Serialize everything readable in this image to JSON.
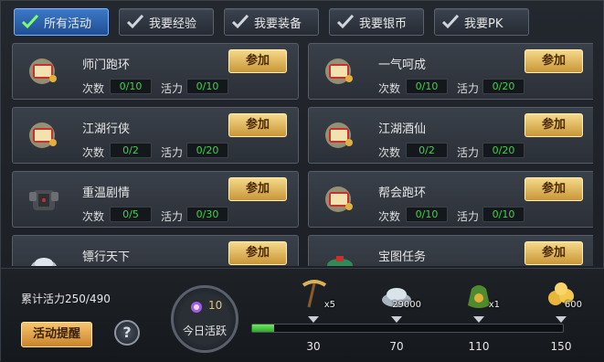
{
  "tabs": [
    {
      "label": "所有活动",
      "active": true
    },
    {
      "label": "我要经验",
      "active": false
    },
    {
      "label": "我要装备",
      "active": false
    },
    {
      "label": "我要银币",
      "active": false
    },
    {
      "label": "我要PK",
      "active": false
    }
  ],
  "labels": {
    "count": "次数",
    "vigor": "活力",
    "join": "参加"
  },
  "activities": [
    {
      "name": "师门跑环",
      "count": "0/10",
      "vigor": "0/10",
      "icon": "scroll-icon"
    },
    {
      "name": "一气呵成",
      "count": "0/10",
      "vigor": "0/20",
      "icon": "scroll-icon"
    },
    {
      "name": "江湖行侠",
      "count": "0/2",
      "vigor": "0/20",
      "icon": "scroll-icon"
    },
    {
      "name": "江湖酒仙",
      "count": "0/2",
      "vigor": "0/20",
      "icon": "scroll-icon"
    },
    {
      "name": "重温剧情",
      "count": "0/5",
      "vigor": "0/30",
      "icon": "armor-icon"
    },
    {
      "name": "帮会跑环",
      "count": "0/10",
      "vigor": "0/10",
      "icon": "scroll-icon"
    },
    {
      "name": "镖行天下",
      "count": "",
      "vigor": "",
      "icon": "silver-icon"
    },
    {
      "name": "宝图任务",
      "count": "",
      "vigor": "",
      "icon": "treasure-map-icon"
    }
  ],
  "bottom": {
    "total_vigor": "累计活力250/490",
    "remind_label": "活动提醒",
    "help_label": "?",
    "today_count": "10",
    "today_label": "今日活跃",
    "progress": 0.07,
    "rewards": [
      {
        "qty": "x5",
        "milestone": "30",
        "icon": "pickaxe-icon"
      },
      {
        "qty": "29000",
        "milestone": "70",
        "icon": "silver-ingot-icon"
      },
      {
        "qty": "x1",
        "milestone": "110",
        "icon": "money-bag-icon"
      },
      {
        "qty": "600",
        "milestone": "150",
        "icon": "gold-coins-icon"
      }
    ]
  },
  "colors": {
    "accent": "#3c78c8",
    "value_green": "#3fd14a",
    "gold_button": "#e9c46a"
  }
}
